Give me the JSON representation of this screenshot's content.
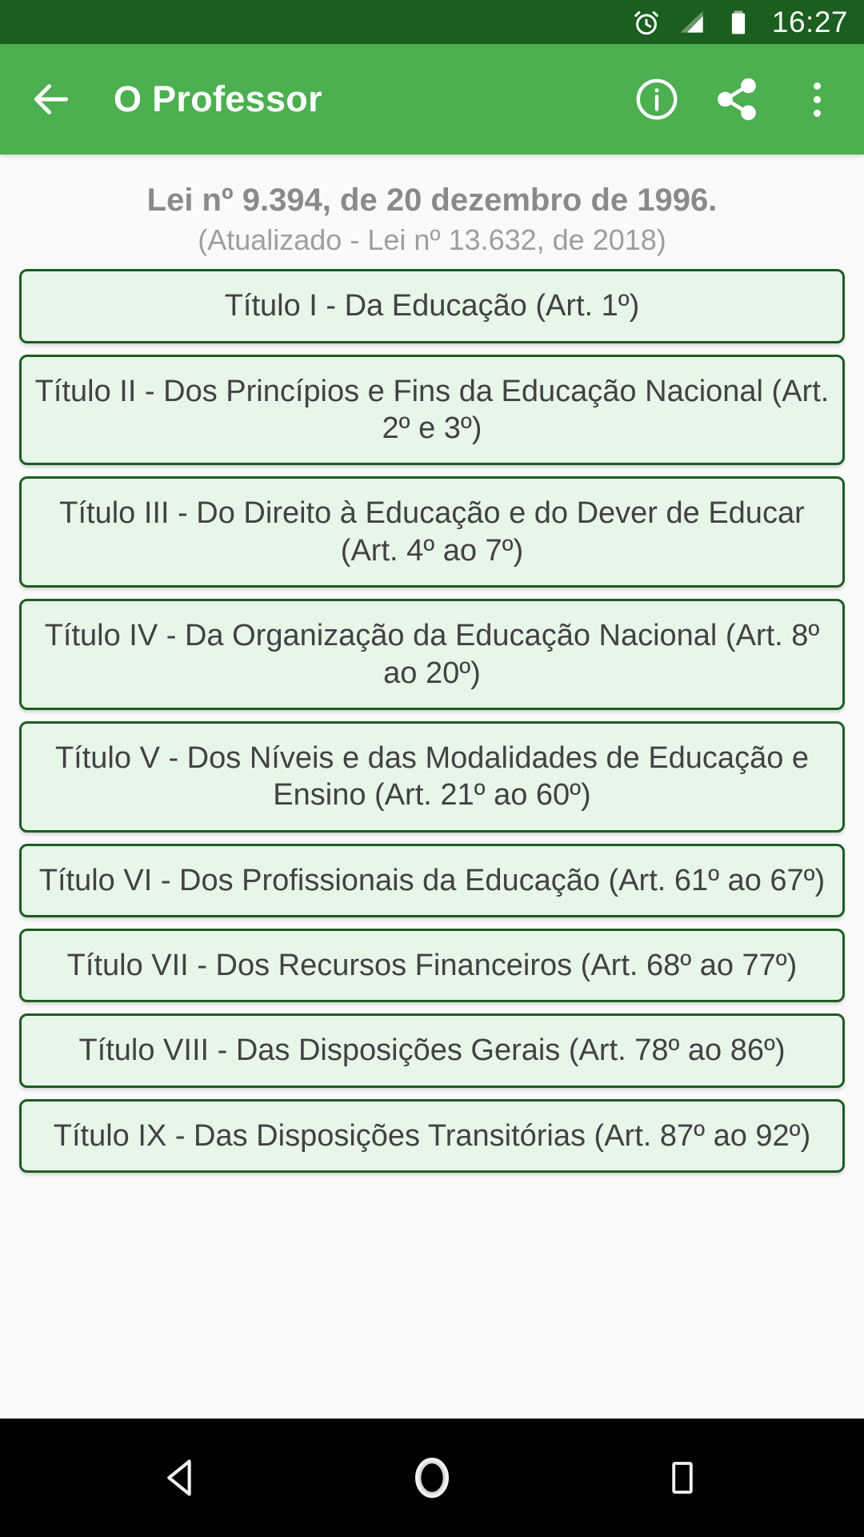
{
  "status_bar": {
    "background": "#1b5e20",
    "time": "16:27",
    "icons": [
      "alarm-icon",
      "signal-icon",
      "battery-icon"
    ]
  },
  "app_bar": {
    "background": "#4caf50",
    "title": "O Professor",
    "back_label": "back-arrow-icon",
    "actions": [
      {
        "name": "info-icon",
        "label": "Info"
      },
      {
        "name": "share-icon",
        "label": "Compartilhar"
      },
      {
        "name": "more-options-icon",
        "label": "Mais opções"
      }
    ]
  },
  "main": {
    "law_title": "Lei nº 9.394, de 20 dezembro de 1996.",
    "law_subtitle": "(Atualizado - Lei nº 13.632, de 2018)",
    "accent_border": "#1b5e20",
    "item_background": "#e8f5e9",
    "items": [
      {
        "label": "Título I - Da Educação (Art. 1º)"
      },
      {
        "label": "Título II - Dos Princípios e Fins da Educação Nacional (Art. 2º e 3º)"
      },
      {
        "label": "Título III - Do Direito à Educação e do Dever de Educar (Art. 4º ao 7º)"
      },
      {
        "label": "Título IV - Da Organização da Educação Nacional (Art. 8º ao 20º)"
      },
      {
        "label": "Título V - Dos Níveis e das Modalidades de Educação e Ensino (Art. 21º ao 60º)"
      },
      {
        "label": "Título VI - Dos Profissionais da Educação (Art. 61º ao 67º)"
      },
      {
        "label": "Título VII - Dos Recursos Financeiros (Art. 68º ao 77º)"
      },
      {
        "label": "Título VIII - Das Disposições Gerais (Art. 78º ao 86º)"
      },
      {
        "label": "Título IX - Das Disposições Transitórias (Art. 87º ao 92º)"
      }
    ]
  },
  "nav_bar": {
    "background": "#000000",
    "buttons": [
      {
        "name": "android-back-button"
      },
      {
        "name": "android-home-button"
      },
      {
        "name": "android-recents-button"
      }
    ]
  }
}
